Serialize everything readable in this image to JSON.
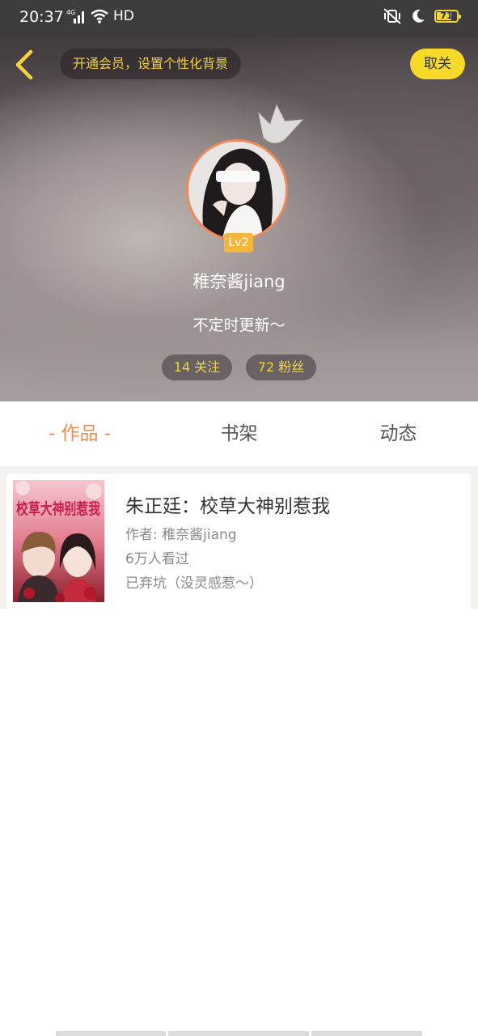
{
  "status": {
    "time": "20:37",
    "network": "4G",
    "hd": "HD",
    "battery": "71"
  },
  "header": {
    "vip_promo": "开通会员，设置个性化背景",
    "follow_label": "取关",
    "level": "Lv2",
    "username": "稚奈酱jiang",
    "bio": "不定时更新～",
    "following": "14 关注",
    "followers": "72 粉丝"
  },
  "tabs": [
    {
      "label": "- 作品 -",
      "active": true
    },
    {
      "label": "书架",
      "active": false
    },
    {
      "label": "动态",
      "active": false
    }
  ],
  "works": [
    {
      "title": "朱正廷：校草大神别惹我",
      "author": "作者: 稚奈酱jiang",
      "views": "6万人看过",
      "status": "已弃坑（没灵感惹～）",
      "cover_text": "校草大神别惹我"
    }
  ],
  "colors": {
    "accent": "#ef8c4d",
    "follow": "#f7d92a",
    "promo_text": "#f4d23d"
  }
}
